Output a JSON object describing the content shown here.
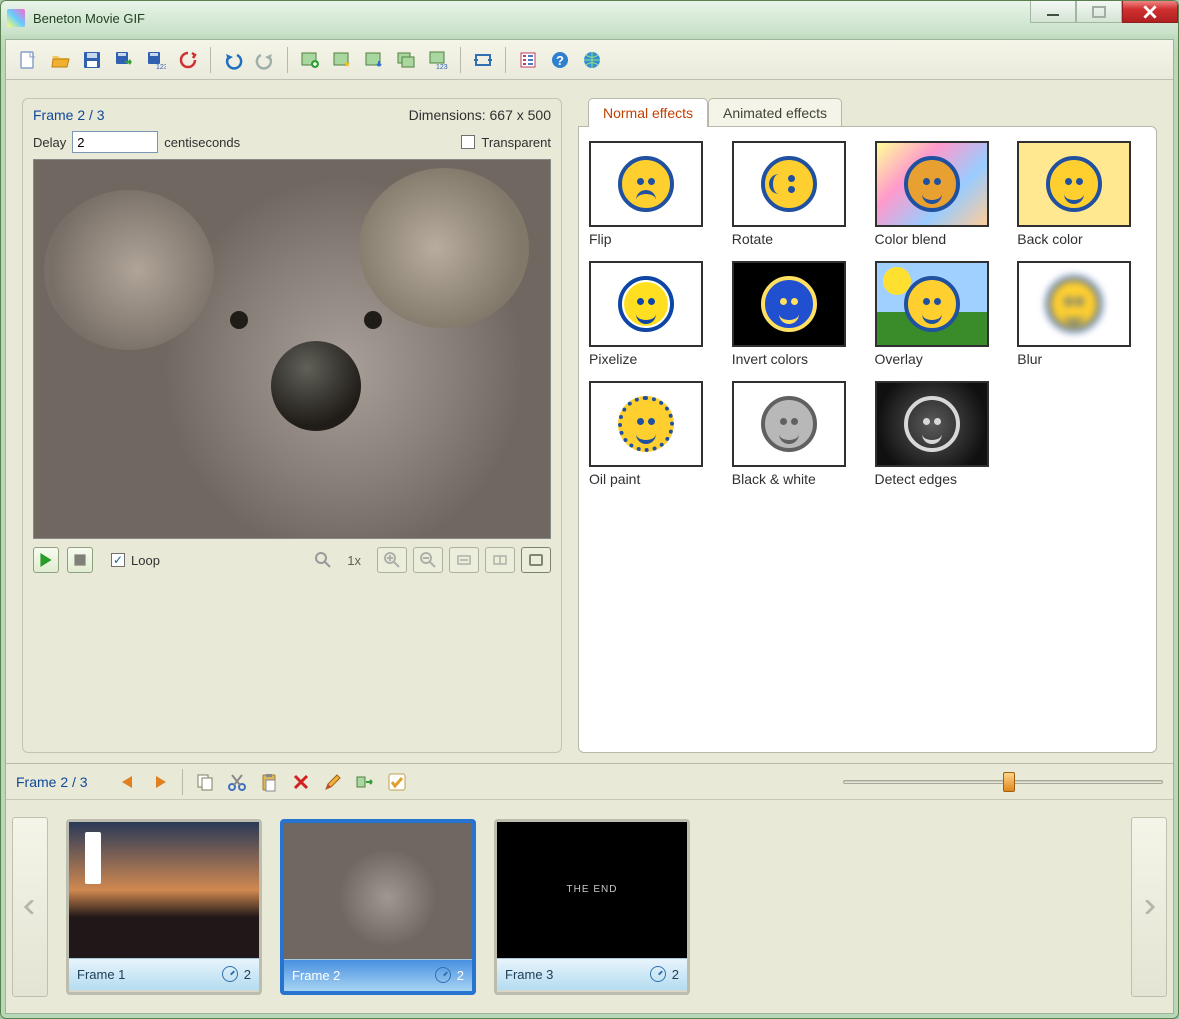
{
  "window": {
    "title": "Beneton Movie GIF"
  },
  "toolbar": {
    "buttons": [
      {
        "name": "new",
        "icon": "file"
      },
      {
        "name": "open",
        "icon": "folder-open"
      },
      {
        "name": "save",
        "icon": "floppy"
      },
      {
        "name": "export",
        "icon": "floppy-arrow"
      },
      {
        "name": "export-sequence",
        "icon": "floppy-123"
      },
      {
        "name": "reload",
        "icon": "recycle"
      },
      {
        "sep": true
      },
      {
        "name": "undo",
        "icon": "undo"
      },
      {
        "name": "redo",
        "icon": "redo"
      },
      {
        "sep": true
      },
      {
        "name": "add-frame",
        "icon": "image-plus"
      },
      {
        "name": "import-image",
        "icon": "image-star"
      },
      {
        "name": "insert-image",
        "icon": "image-down"
      },
      {
        "name": "duplicate-frame",
        "icon": "image-copy"
      },
      {
        "name": "import-sequence",
        "icon": "image-123"
      },
      {
        "sep": true
      },
      {
        "name": "resize",
        "icon": "crop"
      },
      {
        "sep": true
      },
      {
        "name": "settings",
        "icon": "properties"
      },
      {
        "name": "help",
        "icon": "help"
      },
      {
        "name": "website",
        "icon": "globe"
      }
    ]
  },
  "frame_info": {
    "counter": "Frame 2 / 3",
    "dimensions": "Dimensions: 667 x 500",
    "delay_label": "Delay",
    "delay_value": "2",
    "delay_unit": "centiseconds",
    "transparent_label": "Transparent",
    "transparent_checked": false
  },
  "playback": {
    "play_label": "Play",
    "stop_label": "Stop",
    "loop_label": "Loop",
    "loop_checked": true,
    "zoom_text": "1x"
  },
  "effects": {
    "tab_normal": "Normal effects",
    "tab_animated": "Animated effects",
    "items": [
      {
        "key": "flip",
        "label": "Flip"
      },
      {
        "key": "rotate",
        "label": "Rotate"
      },
      {
        "key": "colorblend",
        "label": "Color blend"
      },
      {
        "key": "backcolor",
        "label": "Back color"
      },
      {
        "key": "pixelize",
        "label": "Pixelize"
      },
      {
        "key": "invert",
        "label": "Invert colors"
      },
      {
        "key": "overlay",
        "label": "Overlay"
      },
      {
        "key": "blur",
        "label": "Blur"
      },
      {
        "key": "oil",
        "label": "Oil paint"
      },
      {
        "key": "bw",
        "label": "Black & white"
      },
      {
        "key": "edge",
        "label": "Detect edges"
      }
    ]
  },
  "timeline": {
    "counter": "Frame 2 / 3",
    "slider_value": 50,
    "frames": [
      {
        "label": "Frame 1",
        "delay": "2",
        "selected": false,
        "img": "fimg1",
        "text": ""
      },
      {
        "label": "Frame 2",
        "delay": "2",
        "selected": true,
        "img": "fimg2",
        "text": ""
      },
      {
        "label": "Frame 3",
        "delay": "2",
        "selected": false,
        "img": "fimg3",
        "text": "THE END"
      }
    ],
    "tool_buttons": [
      {
        "name": "prev-frame",
        "icon": "arrow-left",
        "color": "#e08020"
      },
      {
        "name": "next-frame",
        "icon": "arrow-right",
        "color": "#e08020"
      },
      {
        "sep": true
      },
      {
        "name": "copy-frame",
        "icon": "copy"
      },
      {
        "name": "cut-frame",
        "icon": "cut"
      },
      {
        "name": "paste-frame",
        "icon": "paste"
      },
      {
        "name": "delete-frame",
        "icon": "delete",
        "color": "#d02020"
      },
      {
        "name": "edit-frame",
        "icon": "pencil"
      },
      {
        "name": "move-frame",
        "icon": "move-right",
        "color": "#30a030"
      },
      {
        "name": "select-all",
        "icon": "check",
        "color": "#e0a030"
      }
    ]
  }
}
